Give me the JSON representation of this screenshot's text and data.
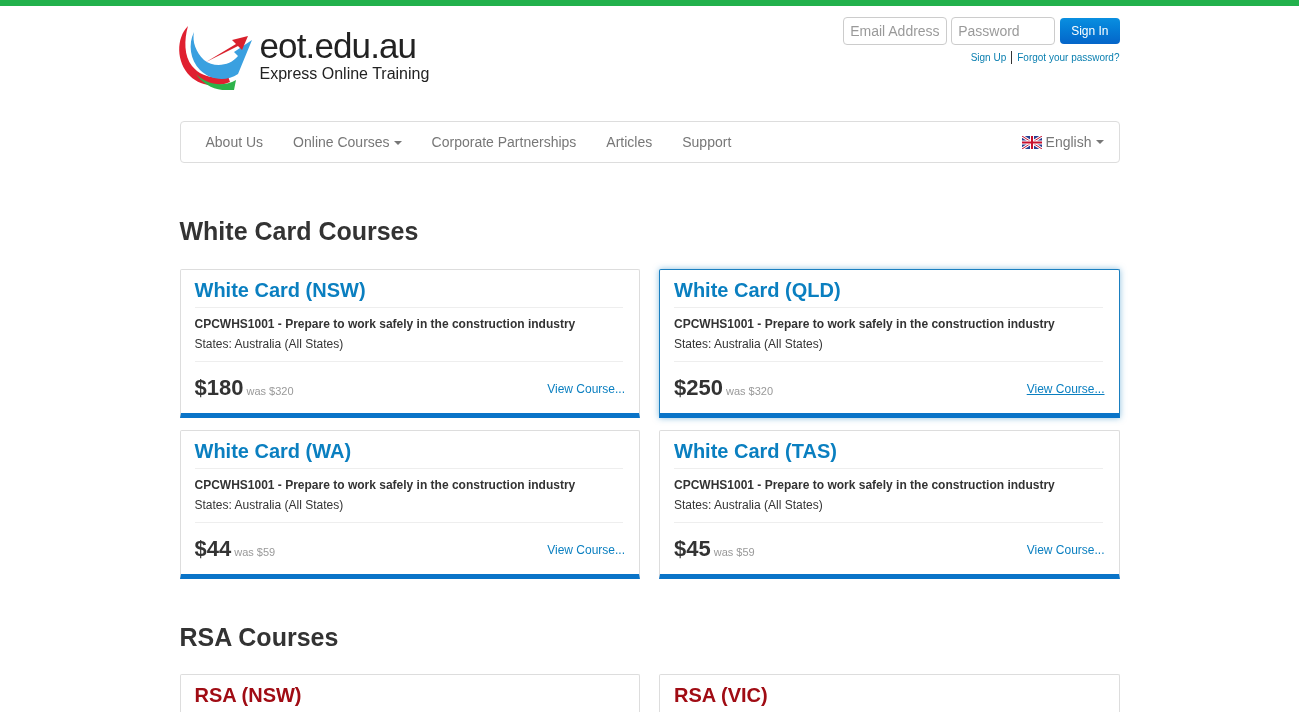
{
  "logo": {
    "domain": "eot.edu.au",
    "tagline": "Express Online Training"
  },
  "login": {
    "email_placeholder": "Email Address",
    "password_placeholder": "Password",
    "button": "Sign In",
    "links": [
      "Sign Up",
      "Forgot your password?"
    ]
  },
  "nav": {
    "items": [
      {
        "label": "About Us",
        "dropdown": false
      },
      {
        "label": "Online Courses",
        "dropdown": true
      },
      {
        "label": "Corporate Partnerships",
        "dropdown": false
      },
      {
        "label": "Articles",
        "dropdown": false
      },
      {
        "label": "Support",
        "dropdown": false
      }
    ],
    "language": "English"
  },
  "sections": [
    {
      "title": "White Card Courses",
      "kind": "whitecard",
      "courses": [
        {
          "title": "White Card (NSW)",
          "unit": "CPCWHS1001 - Prepare to work safely in the construction industry",
          "states": "States: Australia (All States)",
          "price": "$180",
          "was": "was $320",
          "link": "View Course...",
          "hovered": false
        },
        {
          "title": "White Card (QLD)",
          "unit": "CPCWHS1001 - Prepare to work safely in the construction industry",
          "states": "States: Australia (All States)",
          "price": "$250",
          "was": "was $320",
          "link": "View Course...",
          "hovered": true
        },
        {
          "title": "White Card (WA)",
          "unit": "CPCWHS1001 - Prepare to work safely in the construction industry",
          "states": "States: Australia (All States)",
          "price": "$44",
          "was": "was $59",
          "link": "View Course...",
          "hovered": false
        },
        {
          "title": "White Card (TAS)",
          "unit": "CPCWHS1001 - Prepare to work safely in the construction industry",
          "states": "States: Australia (All States)",
          "price": "$45",
          "was": "was $59",
          "link": "View Course...",
          "hovered": false
        }
      ]
    },
    {
      "title": "RSA Courses",
      "kind": "rsa",
      "courses": [
        {
          "title": "RSA (NSW)",
          "hovered": false
        },
        {
          "title": "RSA (VIC)",
          "hovered": false
        }
      ]
    }
  ]
}
